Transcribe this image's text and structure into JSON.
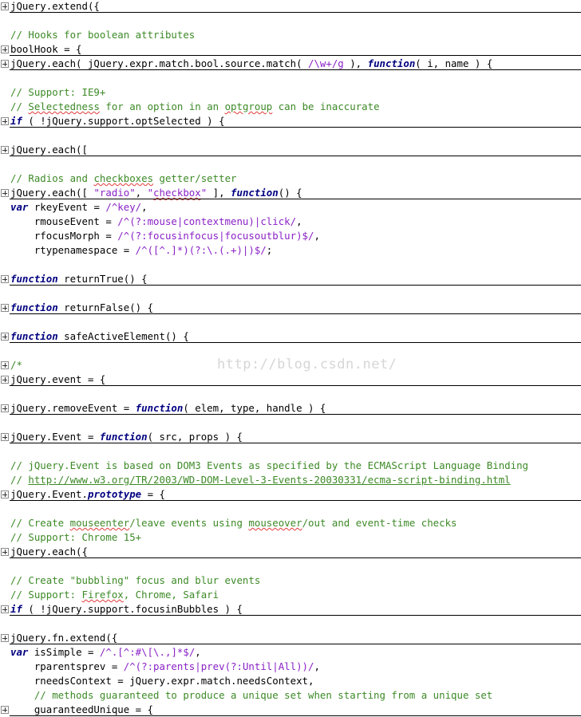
{
  "watermark": "http://blog.csdn.net/",
  "lines": [
    {
      "n": 0,
      "fold": true,
      "segs": [
        [
          "jQuery.extend({",
          ""
        ]
      ]
    },
    {
      "n": 2,
      "fold": false,
      "segs": [
        [
          "// Hooks for boolean attributes",
          "c"
        ]
      ]
    },
    {
      "n": 3,
      "fold": true,
      "segs": [
        [
          "boolHook = {",
          ""
        ]
      ]
    },
    {
      "n": 4,
      "fold": true,
      "segs": [
        [
          "jQuery.each( jQuery.expr.match.bool.source.match( ",
          ""
        ],
        [
          "/\\w+/g",
          "r"
        ],
        [
          " ), ",
          ""
        ],
        [
          "function",
          "k"
        ],
        [
          "( i, name ) {",
          ""
        ]
      ]
    },
    {
      "n": 6,
      "fold": false,
      "segs": [
        [
          "// Support: IE9+",
          "c"
        ]
      ]
    },
    {
      "n": 7,
      "fold": false,
      "segs": [
        [
          "// ",
          "c"
        ],
        [
          "Selectedness",
          "sqc"
        ],
        [
          " for an option in an ",
          "c"
        ],
        [
          "optgroup",
          "sqc"
        ],
        [
          " can be inaccurate",
          "c"
        ]
      ]
    },
    {
      "n": 8,
      "fold": true,
      "segs": [
        [
          "if",
          "k"
        ],
        [
          " ( !jQuery.support.optSelected ) {",
          ""
        ]
      ]
    },
    {
      "n": 10,
      "fold": true,
      "segs": [
        [
          "jQuery.each([",
          ""
        ]
      ]
    },
    {
      "n": 12,
      "fold": false,
      "segs": [
        [
          "// Radios and ",
          "c"
        ],
        [
          "checkboxes",
          "sqc"
        ],
        [
          " getter/setter",
          "c"
        ]
      ]
    },
    {
      "n": 13,
      "fold": true,
      "segs": [
        [
          "jQuery.each([ ",
          ""
        ],
        [
          "\"radio\"",
          "s"
        ],
        [
          ", ",
          ""
        ],
        [
          "\"",
          "s"
        ],
        [
          "checkbox",
          "sqs"
        ],
        [
          "\"",
          "s"
        ],
        [
          " ], ",
          ""
        ],
        [
          "function",
          "k"
        ],
        [
          "() {",
          ""
        ]
      ]
    },
    {
      "n": 14,
      "fold": false,
      "segs": [
        [
          "var",
          "k"
        ],
        [
          " rkeyEvent = ",
          ""
        ],
        [
          "/^key/",
          "r"
        ],
        [
          ",",
          ""
        ]
      ]
    },
    {
      "n": 15,
      "fold": false,
      "segs": [
        [
          "    rmouseEvent = ",
          ""
        ],
        [
          "/^(?:mouse|contextmenu)|click/",
          "r"
        ],
        [
          ",",
          ""
        ]
      ]
    },
    {
      "n": 16,
      "fold": false,
      "segs": [
        [
          "    rfocusMorph = ",
          ""
        ],
        [
          "/^(?:focusinfocus|focusoutblur)$/",
          "r"
        ],
        [
          ",",
          ""
        ]
      ]
    },
    {
      "n": 17,
      "fold": false,
      "segs": [
        [
          "    rtypenamespace = ",
          ""
        ],
        [
          "/^([^.]*)(?:\\.(.+)|)$/",
          "r"
        ],
        [
          ";",
          ""
        ]
      ]
    },
    {
      "n": 19,
      "fold": true,
      "segs": [
        [
          "function",
          "k"
        ],
        [
          " returnTrue() {",
          ""
        ]
      ]
    },
    {
      "n": 21,
      "fold": true,
      "segs": [
        [
          "function",
          "k"
        ],
        [
          " returnFalse() {",
          ""
        ]
      ]
    },
    {
      "n": 23,
      "fold": true,
      "segs": [
        [
          "function",
          "k"
        ],
        [
          " safeActiveElement() {",
          ""
        ]
      ]
    },
    {
      "n": 25,
      "fold": true,
      "segs": [
        [
          "/*",
          "c"
        ]
      ]
    },
    {
      "n": 26,
      "fold": true,
      "segs": [
        [
          "jQuery.event = {",
          ""
        ]
      ]
    },
    {
      "n": 28,
      "fold": true,
      "segs": [
        [
          "jQuery.removeEvent = ",
          ""
        ],
        [
          "function",
          "k"
        ],
        [
          "( elem, type, handle ) {",
          ""
        ]
      ]
    },
    {
      "n": 30,
      "fold": true,
      "segs": [
        [
          "jQuery.Event = ",
          ""
        ],
        [
          "function",
          "k"
        ],
        [
          "( src, props ) {",
          ""
        ]
      ]
    },
    {
      "n": 32,
      "fold": false,
      "segs": [
        [
          "// jQuery.Event is based on DOM3 Events as specified by the ECMAScript Language Binding",
          "c"
        ]
      ]
    },
    {
      "n": 33,
      "fold": false,
      "segs": [
        [
          "// ",
          "c"
        ],
        [
          "http://www.w3.org/TR/2003/WD-DOM-Level-3-Events-20030331/ecma-script-binding.html",
          "u"
        ]
      ]
    },
    {
      "n": 34,
      "fold": true,
      "segs": [
        [
          "jQuery.Event.",
          ""
        ],
        [
          "prototype",
          "k"
        ],
        [
          " = {",
          ""
        ]
      ]
    },
    {
      "n": 36,
      "fold": false,
      "segs": [
        [
          "// Create ",
          "c"
        ],
        [
          "mouseenter",
          "sqc"
        ],
        [
          "/leave events using ",
          "c"
        ],
        [
          "mouseover",
          "sqc"
        ],
        [
          "/out and event-time checks",
          "c"
        ]
      ]
    },
    {
      "n": 37,
      "fold": false,
      "segs": [
        [
          "// Support: Chrome 15+",
          "c"
        ]
      ]
    },
    {
      "n": 38,
      "fold": true,
      "segs": [
        [
          "jQuery.each({",
          ""
        ]
      ]
    },
    {
      "n": 40,
      "fold": false,
      "segs": [
        [
          "// Create \"bubbling\" focus and blur events",
          "c"
        ]
      ]
    },
    {
      "n": 41,
      "fold": false,
      "segs": [
        [
          "// Support: ",
          "c"
        ],
        [
          "Firefox",
          "sqc"
        ],
        [
          ", Chrome, Safari",
          "c"
        ]
      ]
    },
    {
      "n": 42,
      "fold": true,
      "segs": [
        [
          "if",
          "k"
        ],
        [
          " ( !jQuery.support.focusinBubbles ) {",
          ""
        ]
      ]
    },
    {
      "n": 44,
      "fold": true,
      "segs": [
        [
          "jQuery.fn.extend({",
          ""
        ]
      ]
    },
    {
      "n": 45,
      "fold": false,
      "segs": [
        [
          "var",
          "k"
        ],
        [
          " isSimple = ",
          ""
        ],
        [
          "/^.[^:#\\[\\.,]*$/",
          "r"
        ],
        [
          ",",
          ""
        ]
      ]
    },
    {
      "n": 46,
      "fold": false,
      "segs": [
        [
          "    rparentsprev = ",
          ""
        ],
        [
          "/^(?:parents|prev(?:Until|All))/",
          "r"
        ],
        [
          ",",
          ""
        ]
      ]
    },
    {
      "n": 47,
      "fold": false,
      "segs": [
        [
          "    rneedsContext = jQuery.expr.match.needsContext,",
          ""
        ]
      ]
    },
    {
      "n": 48,
      "fold": false,
      "segs": [
        [
          "    // methods guaranteed to produce a unique set when starting from a unique set",
          "c"
        ]
      ]
    },
    {
      "n": 49,
      "fold": true,
      "segs": [
        [
          "    guaranteedUnique = {",
          ""
        ]
      ]
    }
  ],
  "separators_after_lines": [
    0,
    3,
    4,
    8,
    10,
    13,
    19,
    21,
    23,
    26,
    28,
    30,
    34,
    38,
    42,
    44,
    49
  ]
}
